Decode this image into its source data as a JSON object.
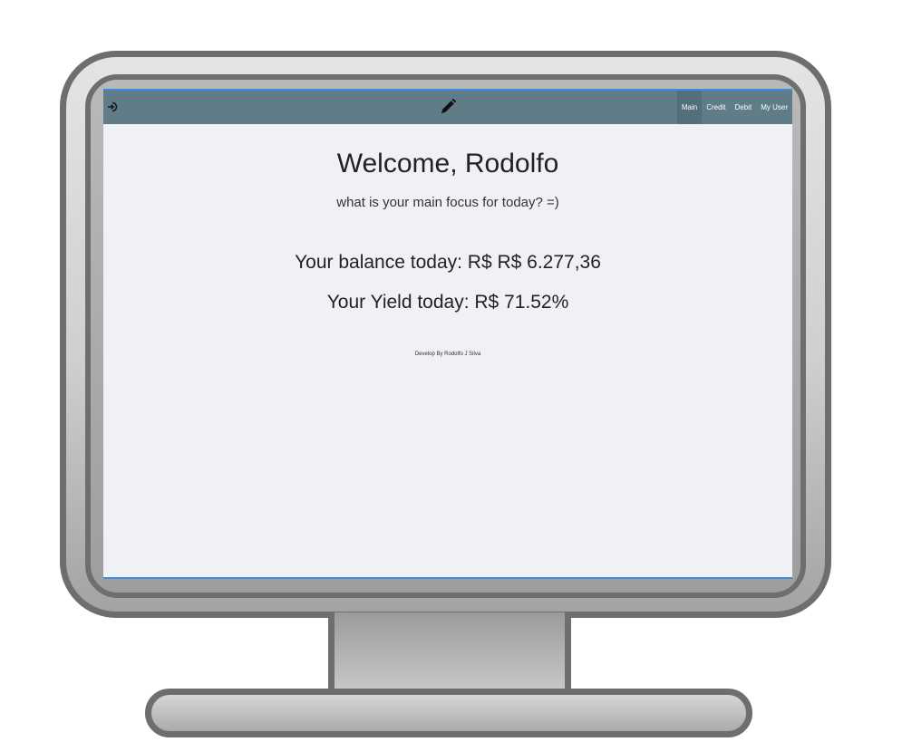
{
  "navbar": {
    "items": [
      {
        "label": "Main",
        "active": true
      },
      {
        "label": "Credit",
        "active": false
      },
      {
        "label": "Debit",
        "active": false
      },
      {
        "label": "My User",
        "active": false
      }
    ],
    "left_icon": "logout-icon",
    "center_icon": "pencil-icon"
  },
  "main": {
    "title": "Welcome, Rodolfo",
    "subtitle": "what is your main focus for today? =)",
    "balance": "Your balance today: R$ R$ 6.277,36",
    "yield": "Your Yield today: R$ 71.52%",
    "footer": "Develop By Rodolfo J Silva"
  },
  "colors": {
    "navbar_bg": "#5f7c87",
    "navbar_active_bg": "#546f7a",
    "screen_bg": "#f0f1f4",
    "accent_border": "#3f8be0"
  }
}
